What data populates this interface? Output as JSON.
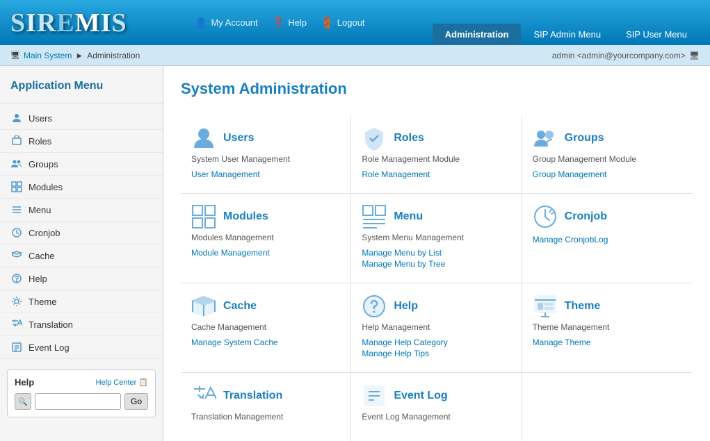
{
  "header": {
    "logo": "SIREMIS",
    "nav": [
      {
        "label": "My Account",
        "icon": "user-icon"
      },
      {
        "label": "Help",
        "icon": "help-icon"
      },
      {
        "label": "Logout",
        "icon": "logout-icon"
      }
    ],
    "tabs": [
      {
        "label": "Administration",
        "active": true
      },
      {
        "label": "SIP Admin Menu",
        "active": false
      },
      {
        "label": "SIP User Menu",
        "active": false
      }
    ]
  },
  "breadcrumb": {
    "items": [
      "Main System",
      "Administration"
    ],
    "separator": "►",
    "user": "admin <admin@yourcompany.com>"
  },
  "sidebar": {
    "title": "Application Menu",
    "items": [
      {
        "label": "Users",
        "icon": "users-icon"
      },
      {
        "label": "Roles",
        "icon": "roles-icon"
      },
      {
        "label": "Groups",
        "icon": "groups-icon"
      },
      {
        "label": "Modules",
        "icon": "modules-icon"
      },
      {
        "label": "Menu",
        "icon": "menu-icon"
      },
      {
        "label": "Cronjob",
        "icon": "cronjob-icon"
      },
      {
        "label": "Cache",
        "icon": "cache-icon"
      },
      {
        "label": "Help",
        "icon": "help-icon"
      },
      {
        "label": "Theme",
        "icon": "theme-icon"
      },
      {
        "label": "Translation",
        "icon": "translation-icon"
      },
      {
        "label": "Event Log",
        "icon": "eventlog-icon"
      }
    ],
    "help": {
      "title": "Help",
      "center_label": "Help Center",
      "search_placeholder": "",
      "go_button": "Go"
    }
  },
  "content": {
    "title": "System Administration",
    "modules": [
      {
        "id": "users",
        "title": "Users",
        "subtitle": "System User Management",
        "links": [
          "User Management"
        ]
      },
      {
        "id": "roles",
        "title": "Roles",
        "subtitle": "Role Management Module",
        "links": [
          "Role Management"
        ]
      },
      {
        "id": "groups",
        "title": "Groups",
        "subtitle": "Group Management Module",
        "links": [
          "Group Management"
        ]
      },
      {
        "id": "modules",
        "title": "Modules",
        "subtitle": "Modules Management",
        "links": [
          "Module Management"
        ]
      },
      {
        "id": "menu",
        "title": "Menu",
        "subtitle": "System Menu Management",
        "links": [
          "Manage Menu by List",
          "Manage Menu by Tree"
        ]
      },
      {
        "id": "cronjob",
        "title": "Cronjob",
        "subtitle": "",
        "links": [
          "Manage CronjobLog"
        ]
      },
      {
        "id": "cache",
        "title": "Cache",
        "subtitle": "Cache Management",
        "links": [
          "Manage System Cache"
        ]
      },
      {
        "id": "help",
        "title": "Help",
        "subtitle": "Help Management",
        "links": [
          "Manage Help Category",
          "Manage Help Tips"
        ]
      },
      {
        "id": "theme",
        "title": "Theme",
        "subtitle": "Theme Management",
        "links": [
          "Manage Theme"
        ]
      },
      {
        "id": "translation",
        "title": "Translation",
        "subtitle": "Translation Management",
        "links": []
      },
      {
        "id": "eventlog",
        "title": "Event Log",
        "subtitle": "Event Log Management",
        "links": []
      }
    ]
  }
}
